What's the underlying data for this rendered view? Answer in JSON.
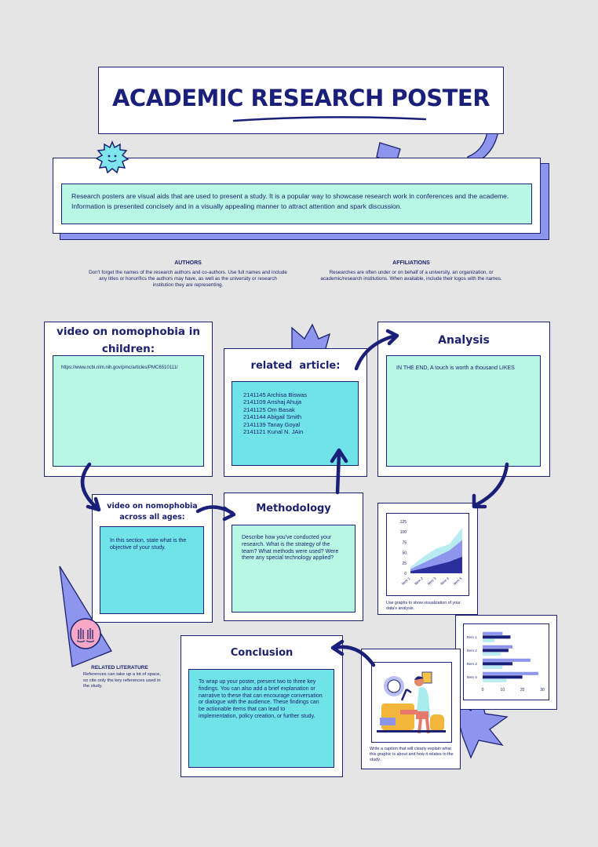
{
  "title": "ACADEMIC RESEARCH POSTER",
  "intro": "Research posters are visual aids that are used to present a study. It is a popular way to showcase research work in conferences and the academe. Information is presented concisely and in a visually appealing manner to attract attention and spark discussion.",
  "authors": {
    "heading": "AUTHORS",
    "text": "Don't forget the names of the research authors and co-authors. Use full names and include any titles or honorifics the authors may have, as well as the university or research institution they are representing."
  },
  "affiliations": {
    "heading": "AFFILIATIONS",
    "text": "Researches are often under or on behalf of a university, an organization, or academic/research institutions. When available, include their logos with the names."
  },
  "video_children": {
    "title": "video on nomophobia in children:",
    "url": "https://www.ncbi.nlm.nih.gov/pmc/articles/PMC6510111/"
  },
  "related_article": {
    "title": "related  article:",
    "members": [
      "2141145 Archisa Biswas",
      "2141109 Anshaj Ahuja",
      "2141125 Om Basak",
      "2141144 Abigail Smith",
      "2141139 Tanay Goyal",
      "2141121 Kunal N. JAin"
    ]
  },
  "analysis": {
    "title": "Analysis",
    "text": "IN THE END, A touch is worth a thousand LIKES"
  },
  "video_all_ages": {
    "title": "video on  nomophobia across all ages:",
    "text": "In this section, state what is the objective of your study."
  },
  "methodology": {
    "title": "Methodology",
    "text": "Describe how you've conducted your research. What is the strategy of the team? What methods were used? Were there any special technology applied?"
  },
  "area_chart_caption": "Use graphs to show visualization of your data's analysis.",
  "conclusion": {
    "title": "Conclusion",
    "text": "To wrap up your poster, present two to three key findings. You can also add a brief explanation or narrative to these that can encourage conversation or dialogue with the audience. These findings can be actionable items that can lead to implementation, policy creation, or further study."
  },
  "related_literature": {
    "heading": "RELATED LITERATURE",
    "text": "References can take up a lot of space, so cite only the key references used in the study."
  },
  "image_caption": "Write a caption that will clearly explain what this graphic is about and how it relates to the study.",
  "chart_data": [
    {
      "type": "area",
      "categories": [
        "Item 1",
        "Item 2",
        "Item 3",
        "Item 4",
        "Item 5"
      ],
      "yticks": [
        "125",
        "100",
        "75",
        "50",
        "25",
        "0"
      ],
      "ylim": [
        0,
        125
      ],
      "series": [
        {
          "values": [
            15,
            40,
            60,
            70,
            110
          ],
          "color": "#b7ecf0"
        },
        {
          "values": [
            10,
            25,
            40,
            55,
            80
          ],
          "color": "#8e95ee"
        },
        {
          "values": [
            5,
            12,
            20,
            28,
            40
          ],
          "color": "#2b2f9e"
        }
      ]
    },
    {
      "type": "bar",
      "categories": [
        "Item 1",
        "Item 2",
        "Item 3",
        "Item 4"
      ],
      "xticks": [
        "0",
        "10",
        "20",
        "30"
      ],
      "xlim": [
        0,
        30
      ],
      "series": [
        {
          "values": [
            10,
            15,
            24,
            28
          ],
          "color": "#8e95ee"
        },
        {
          "values": [
            14,
            13,
            15,
            20
          ],
          "color": "#1a1f7a"
        },
        {
          "values": [
            6,
            9,
            10,
            12
          ],
          "color": "#b7ecf0"
        }
      ]
    }
  ],
  "colors": {
    "navy": "#1c2270",
    "periwinkle": "#8e95ee",
    "mint": "#b8f7e4",
    "cyan": "#6fe3e8",
    "background": "#e4e5e4"
  }
}
